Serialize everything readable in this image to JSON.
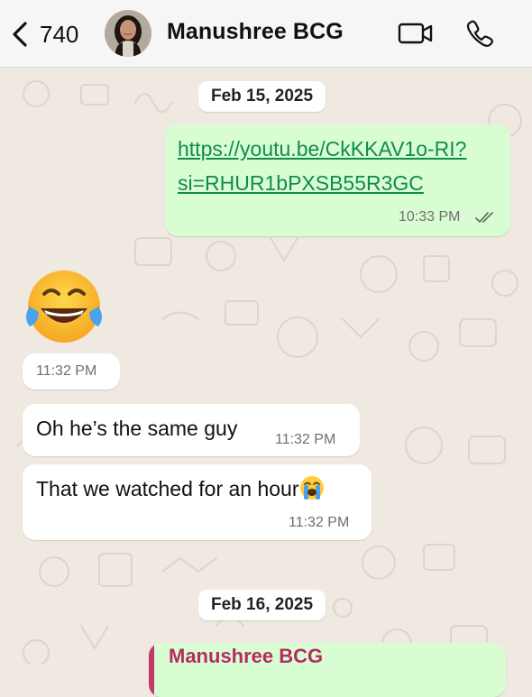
{
  "header": {
    "back_count": "740",
    "contact_name": "Manushree BCG",
    "icons": [
      "chevron-left-icon",
      "video-camera-icon",
      "phone-icon"
    ]
  },
  "dates": {
    "first": "Feb 15, 2025",
    "second": "Feb 16, 2025"
  },
  "messages": [
    {
      "direction": "outgoing",
      "text_line1": "https://youtu.be/CkKKAV1o-RI?",
      "text_line2": "si=RHUR1bPXSB55R3GC",
      "time": "10:33 PM",
      "status": "read"
    },
    {
      "direction": "incoming",
      "emoji": "face-with-tears-of-joy",
      "time": "11:32 PM"
    },
    {
      "direction": "incoming",
      "text": "Oh he’s the same guy",
      "time": "11:32 PM"
    },
    {
      "direction": "incoming",
      "text": "That we watched for an hour",
      "emoji": "loudly-crying-face",
      "time": "11:32 PM"
    },
    {
      "direction": "outgoing",
      "quoted_name": "Manushree BCG"
    }
  ],
  "colors": {
    "outgoing_bubble": "#d9fdd3",
    "incoming_bubble": "#ffffff",
    "link": "#128c4b",
    "read_ticks": "#6f6f6f",
    "wallpaper": "#efe9e1",
    "quote_accent": "#c23a6b"
  }
}
